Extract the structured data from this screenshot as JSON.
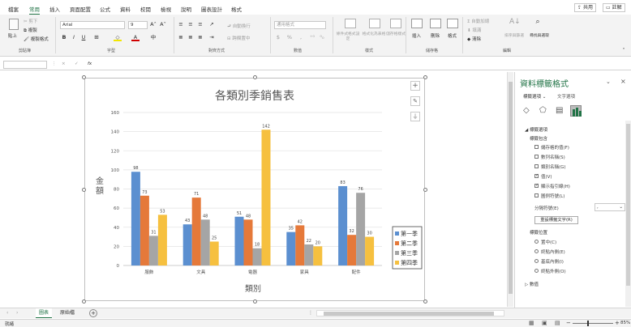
{
  "menu": {
    "tabs": [
      "檔案",
      "常用",
      "插入",
      "頁面配置",
      "公式",
      "資料",
      "校閱",
      "檢視",
      "說明",
      "圖表設計",
      "格式"
    ],
    "share": "共用",
    "comments": "註解"
  },
  "ribbon": {
    "paste": "貼上",
    "cut": "剪下",
    "copy": "複製",
    "format_painter": "複製格式",
    "font_name": "Arial",
    "font_size": "9",
    "wrap_text": "自動換行",
    "merge_center": "跨欄置中",
    "number_format": "通用格式",
    "conditional_format": "條件式格式設定",
    "format_as_table": "格式化為表格",
    "cell_styles": "儲存格樣式",
    "insert": "插入",
    "delete": "刪除",
    "format": "格式",
    "autosum": "自動加總",
    "fill": "填滿",
    "clear": "清除",
    "sort_filter": "排序與篩選",
    "find_select": "尋找與選取",
    "groups": {
      "clipboard": "剪貼簿",
      "font": "字型",
      "alignment": "對齊方式",
      "number": "數值",
      "styles": "樣式",
      "cells": "儲存格",
      "editing": "編輯"
    }
  },
  "formula_bar": {
    "name_box": "",
    "cancel": "×",
    "enter": "✓",
    "fx": "fx",
    "formula": ""
  },
  "chart_data": {
    "type": "bar",
    "title": "各類別季銷售表",
    "xlabel": "類別",
    "ylabel": "金額",
    "categories": [
      "服飾",
      "文具",
      "電器",
      "家具",
      "配件"
    ],
    "series": [
      {
        "name": "第一季",
        "values": [
          98,
          43,
          51,
          35,
          83
        ],
        "color": "#5b8fd0"
      },
      {
        "name": "第二季",
        "values": [
          73,
          71,
          48,
          42,
          32
        ],
        "color": "#e5793a"
      },
      {
        "name": "第三季",
        "values": [
          31,
          48,
          18,
          22,
          76
        ],
        "color": "#a5a5a5"
      },
      {
        "name": "第四季",
        "values": [
          53,
          25,
          142,
          20,
          30
        ],
        "color": "#f6c03f"
      }
    ],
    "ylim": [
      0,
      160
    ],
    "yticks": [
      0,
      20,
      40,
      60,
      80,
      100,
      120,
      140,
      160
    ],
    "grid": true,
    "legend": "right"
  },
  "pane": {
    "title": "資料標籤格式",
    "tab_label_options": "標籤選項",
    "tab_text_options": "文字選項",
    "section_label_options": "標籤選項",
    "label_contains": "標籤包含",
    "options": [
      {
        "label": "儲存格的值(F)",
        "checked": false
      },
      {
        "label": "數列名稱(S)",
        "checked": false
      },
      {
        "label": "類別名稱(G)",
        "checked": false
      },
      {
        "label": "值(V)",
        "checked": true
      },
      {
        "label": "顯示指引線(H)",
        "checked": true
      },
      {
        "label": "圖例符號(L)",
        "checked": false
      }
    ],
    "separator_label": "分隔符號(E)",
    "separator_value": ",",
    "reset_button": "重設標籤文字(R)",
    "label_position": "標籤位置",
    "positions": [
      {
        "label": "置中(C)",
        "selected": false
      },
      {
        "label": "終點內側(E)",
        "selected": false
      },
      {
        "label": "基底內側(I)",
        "selected": false
      },
      {
        "label": "終點外側(O)",
        "selected": false
      }
    ],
    "number_section": "數值"
  },
  "sheets": {
    "tabs": [
      "圖表",
      "原始檔"
    ],
    "active": 0,
    "add": "+"
  },
  "status": {
    "mode": "就緒",
    "zoom": "85%"
  }
}
